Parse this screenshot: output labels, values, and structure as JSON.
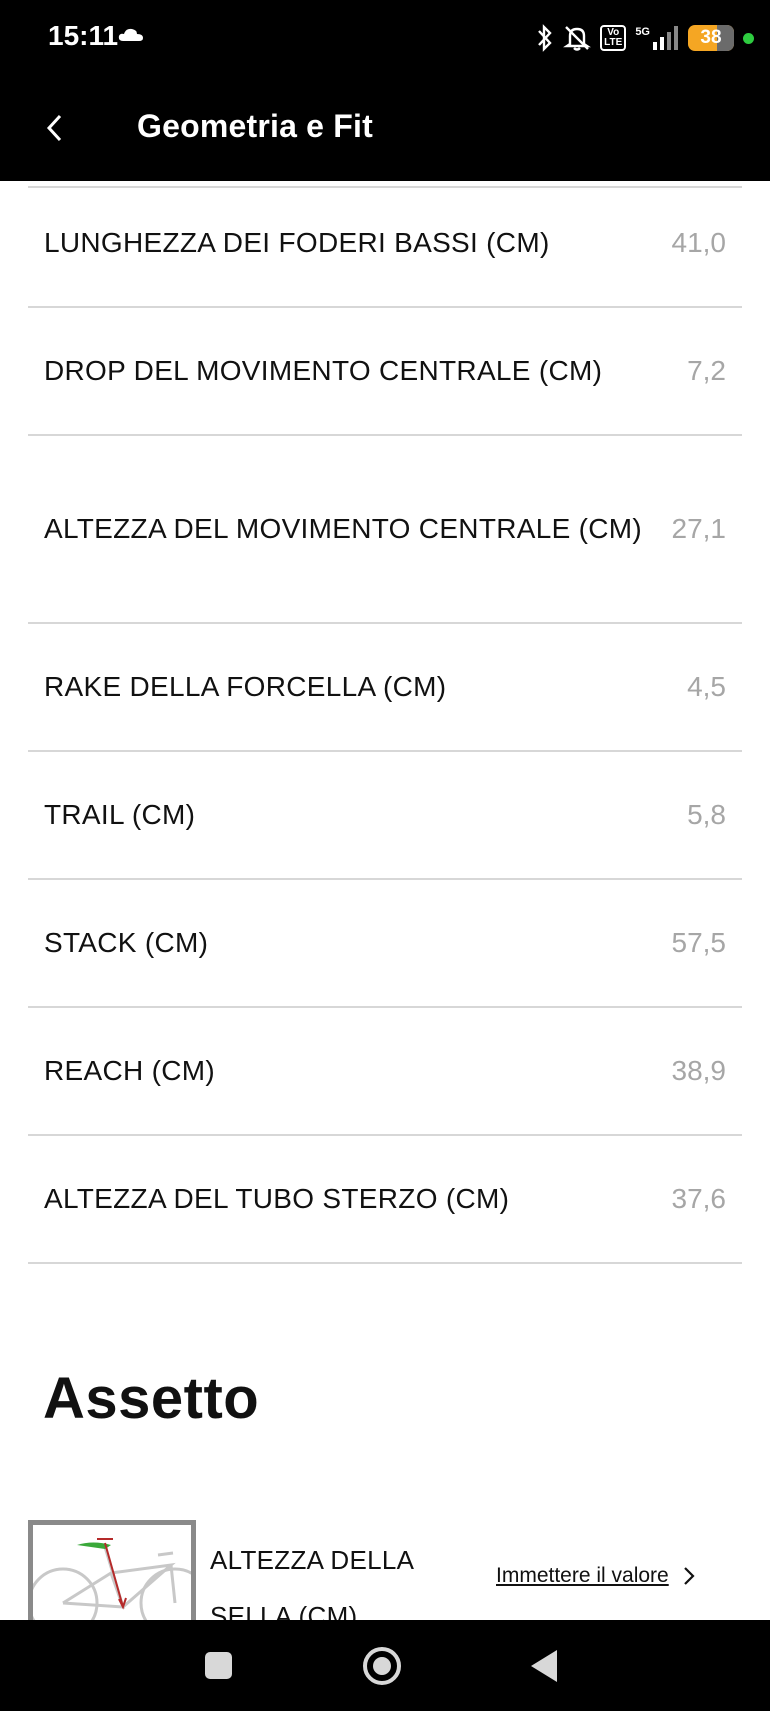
{
  "status_bar": {
    "time": "15:11",
    "battery": "38",
    "volte": "Vo LTE",
    "network": "5G",
    "icons": [
      "cloud-icon",
      "bluetooth-icon",
      "bell-off-icon",
      "volte-icon",
      "signal-icon",
      "battery-icon",
      "dot-icon"
    ]
  },
  "header": {
    "title": "Geometria e Fit",
    "back_icon": "chevron-left-icon"
  },
  "geometry": [
    {
      "label": "LUNGHEZZA DEI FODERI BASSI (CM)",
      "value": "41,0"
    },
    {
      "label": "DROP DEL MOVIMENTO CENTRALE (CM)",
      "value": "7,2"
    },
    {
      "label": "ALTEZZA DEL MOVIMENTO CENTRALE (CM)",
      "value": "27,1"
    },
    {
      "label": "RAKE DELLA FORCELLA (CM)",
      "value": "4,5"
    },
    {
      "label": "TRAIL (CM)",
      "value": "5,8"
    },
    {
      "label": "STACK (CM)",
      "value": "57,5"
    },
    {
      "label": "REACH (CM)",
      "value": "38,9"
    },
    {
      "label": "ALTEZZA DEL TUBO STERZO (CM)",
      "value": "37,6"
    }
  ],
  "assetto": {
    "title": "Assetto",
    "items": [
      {
        "label": "ALTEZZA DELLA SELLA (CM)",
        "action": "Immettere il valore",
        "thumb_icon": "bike-saddle-height-icon"
      }
    ]
  },
  "colors": {
    "bar_bg": "#000000",
    "value_grey": "#a6a6a6",
    "divider": "#d7d7d7",
    "battery": "#f5a623",
    "status_dot": "#2ecc40"
  },
  "nav_bar": {
    "icons": [
      "recents-icon",
      "home-icon",
      "back-icon"
    ]
  }
}
